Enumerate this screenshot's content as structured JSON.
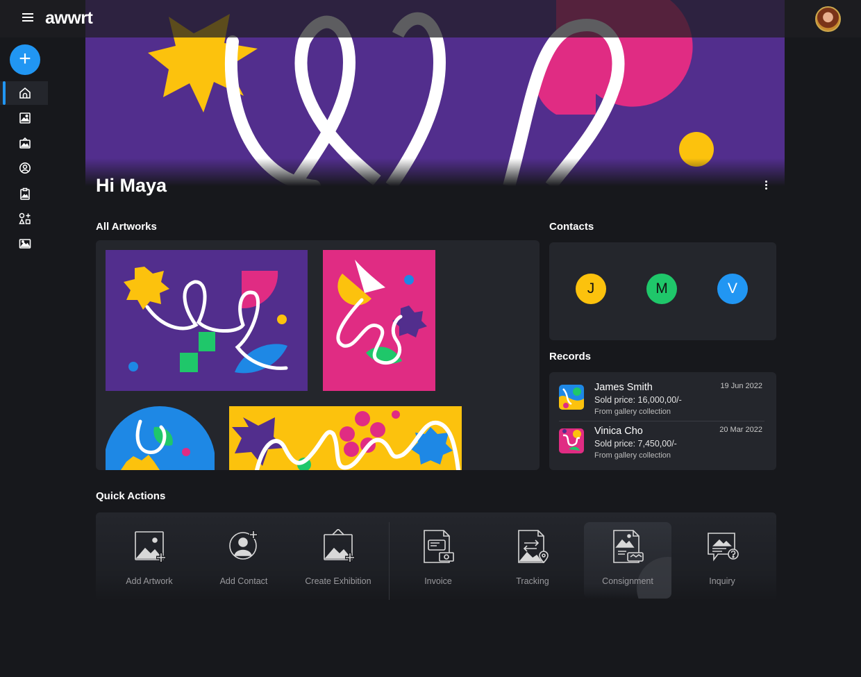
{
  "app": {
    "logo": "awwrt",
    "icons": {
      "menu": "hamburger-menu-icon",
      "avatar": "user-avatar"
    }
  },
  "sidebar": {
    "add_icon": "plus-icon",
    "items": [
      {
        "id": "home",
        "icon": "home-icon",
        "active": true
      },
      {
        "id": "artworks",
        "icon": "image-icon",
        "active": false
      },
      {
        "id": "exhibitions",
        "icon": "exhibition-icon",
        "active": false
      },
      {
        "id": "contacts",
        "icon": "user-circle-icon",
        "active": false
      },
      {
        "id": "records",
        "icon": "clipboard-icon",
        "active": false
      },
      {
        "id": "quick-actions",
        "icon": "shapes-icon",
        "active": false
      },
      {
        "id": "gallery",
        "icon": "gallery-icon",
        "active": false
      }
    ]
  },
  "hero": {
    "greeting": "Hi Maya",
    "menu_icon": "more-vertical-icon"
  },
  "artworks_section": {
    "title": "All Artworks",
    "items": [
      {
        "id": "artwork-1",
        "background": "#522e8d"
      },
      {
        "id": "artwork-2",
        "background": "#e02c83"
      },
      {
        "id": "artwork-3",
        "background": "#1e88e5"
      },
      {
        "id": "artwork-4",
        "background": "#fcc20d"
      }
    ]
  },
  "contacts_section": {
    "title": "Contacts",
    "contacts": [
      {
        "initial": "J",
        "color": "#fcc20d"
      },
      {
        "initial": "M",
        "color": "#1fc76a"
      },
      {
        "initial": "V",
        "color": "#2196f3"
      }
    ]
  },
  "records_section": {
    "title": "Records",
    "records": [
      {
        "name": "James Smith",
        "price": "Sold price: 16,000,00/-",
        "source": "From gallery collection",
        "date": "19 Jun 2022"
      },
      {
        "name": "Vinica Cho",
        "price": "Sold price: 7,450,00/-",
        "source": "From gallery collection",
        "date": "20 Mar 2022"
      }
    ]
  },
  "quick_actions": {
    "title": "Quick Actions",
    "items": [
      {
        "label": "Add Artwork",
        "icon": "add-artwork-icon"
      },
      {
        "label": "Add Contact",
        "icon": "add-contact-icon"
      },
      {
        "label": "Create Exhibition",
        "icon": "create-exhibition-icon"
      },
      {
        "label": "Invoice",
        "icon": "invoice-icon"
      },
      {
        "label": "Tracking",
        "icon": "tracking-icon"
      },
      {
        "label": "Consignment",
        "icon": "consignment-icon",
        "selected": true
      },
      {
        "label": "Inquiry",
        "icon": "inquiry-icon"
      }
    ]
  },
  "colors": {
    "accent": "#2196f3",
    "background": "#17181c",
    "panel": "#24262c",
    "purple": "#522e8d",
    "pink": "#e02c83",
    "yellow": "#fcc20d",
    "green": "#1fc76a"
  }
}
